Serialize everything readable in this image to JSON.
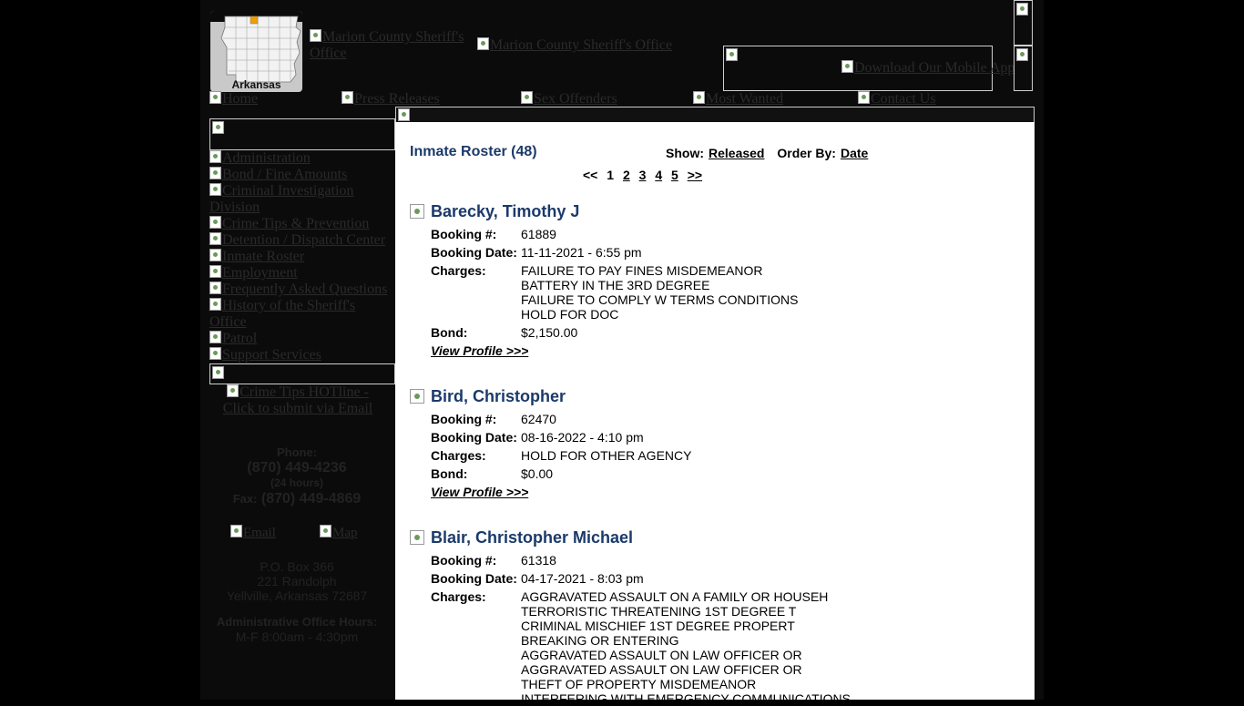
{
  "header": {
    "logo_label": "Arkansas",
    "title_image_alt_1": "Marion County Sheriff's Office",
    "title_image_alt_2": "Marion County Sheriff's Office",
    "mobile_app_alt": "Download Our Mobile App"
  },
  "nav": {
    "items": [
      "Home",
      "Press Releases",
      "Sex Offenders",
      "Most Wanted",
      "Contact Us"
    ]
  },
  "sidebar": {
    "items": [
      "Administration",
      "Bond / Fine Amounts",
      "Criminal Investigation Division",
      "Crime Tips & Prevention",
      "Detention / Dispatch Center",
      "Inmate Roster",
      "Employment",
      "Frequently Asked Questions",
      "History of the Sheriff's Office",
      "Patrol",
      "Support Services"
    ],
    "hotline_alt": "Crime Tips HOTline - Click to submit via Email",
    "contact": {
      "phone_label": "Phone:",
      "phone": "(870) 449-4236",
      "phone_note": "(24 hours)",
      "fax_label": "Fax:",
      "fax": "(870) 449-4869",
      "email_alt": "Email",
      "map_alt": "Map",
      "address_1": "P.O. Box 366",
      "address_2": "221 Randolph",
      "address_3": "Yellville, Arkansas 72687",
      "hours_label": "Administrative Office Hours:",
      "hours": "M-F 8:00am - 4:30pm"
    }
  },
  "roster": {
    "title": "Inmate Roster (48)",
    "show_label": "Show:",
    "show_value": "Released",
    "order_label": "Order By:",
    "order_value": "Date",
    "pager": {
      "prev": "<<",
      "current": "1",
      "pages": [
        "2",
        "3",
        "4",
        "5"
      ],
      "next": ">>"
    },
    "labels": {
      "booking_no": "Booking #:",
      "booking_date": "Booking Date:",
      "charges": "Charges:",
      "bond": "Bond:",
      "view_profile": "View Profile >>>"
    },
    "inmates": [
      {
        "name": "Barecky, Timothy J",
        "booking_no": "61889",
        "booking_date": "11-11-2021 - 6:55 pm",
        "charges": [
          "FAILURE TO PAY FINES MISDEMEANOR",
          "BATTERY IN THE 3RD DEGREE",
          "FAILURE TO COMPLY W TERMS CONDITIONS",
          "HOLD FOR DOC"
        ],
        "bond": "$2,150.00"
      },
      {
        "name": "Bird, Christopher",
        "booking_no": "62470",
        "booking_date": "08-16-2022 - 4:10 pm",
        "charges": [
          "HOLD FOR OTHER AGENCY"
        ],
        "bond": "$0.00"
      },
      {
        "name": "Blair, Christopher Michael",
        "booking_no": "61318",
        "booking_date": "04-17-2021 - 8:03 pm",
        "charges": [
          "AGGRAVATED ASSAULT ON A FAMILY OR HOUSEH",
          "TERRORISTIC THREATENING 1ST DEGREE T",
          "CRIMINAL MISCHIEF 1ST DEGREE PROPERT",
          "BREAKING OR ENTERING",
          "AGGRAVATED ASSAULT ON LAW OFFICER OR",
          "AGGRAVATED ASSAULT ON LAW OFFICER OR",
          "THEFT OF PROPERTY MISDEMEANOR",
          "INTERFERING WITH EMERGENCY COMMUNICATIONS"
        ],
        "bond": ""
      }
    ]
  }
}
